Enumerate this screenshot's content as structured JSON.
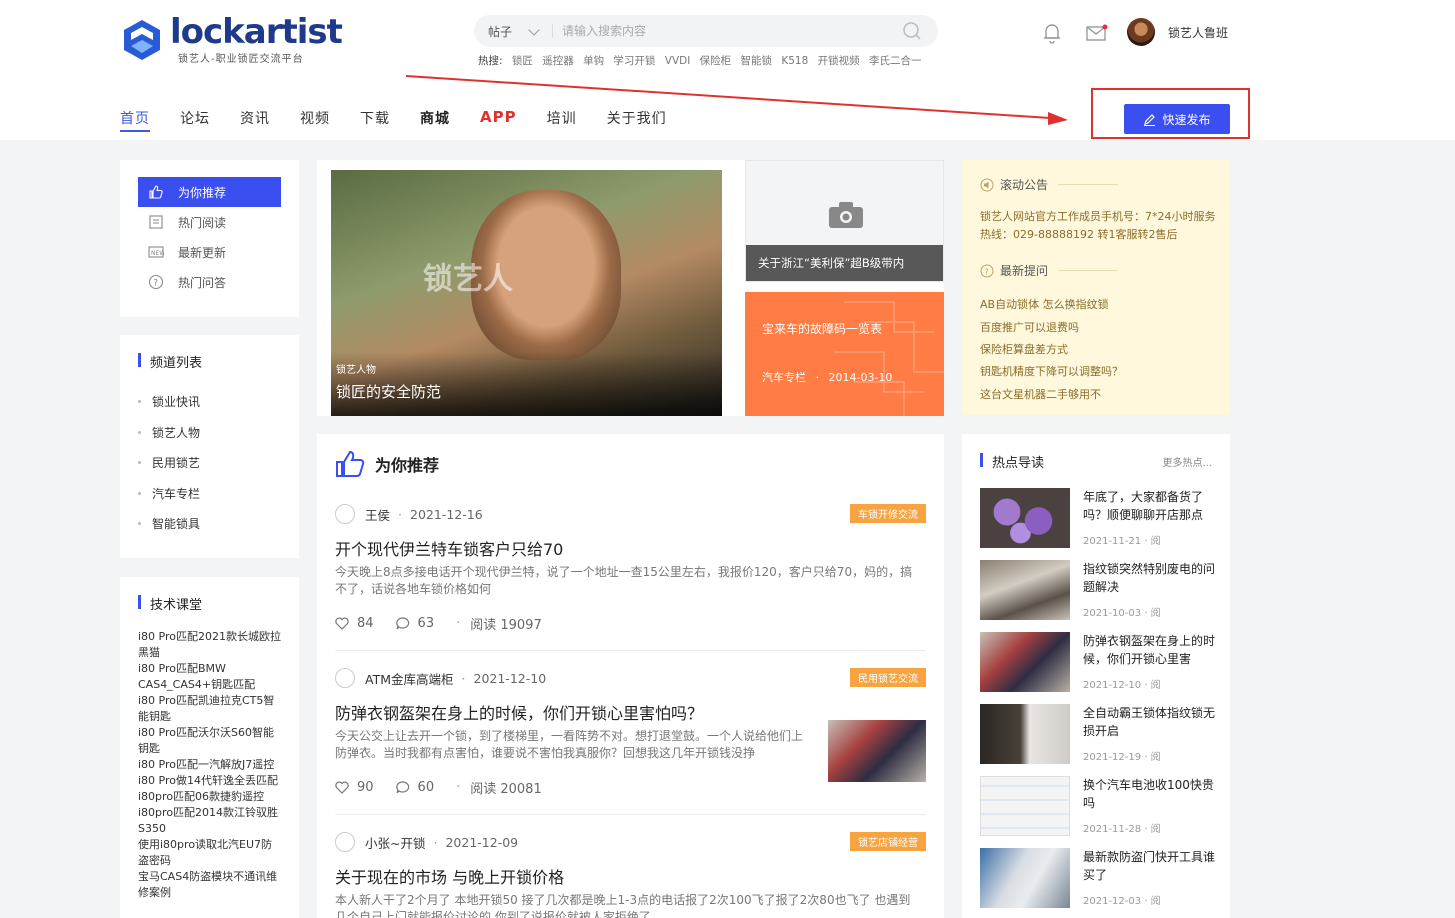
{
  "header": {
    "logo_text": "lockartist",
    "logo_tagline": "锁艺人-职业锁匠交流平台",
    "search": {
      "category": "帖子",
      "placeholder": "请输入搜索内容"
    },
    "hot_label": "热搜:",
    "hot_terms": [
      "锁匠",
      "遥控器",
      "单钩",
      "学习开锁",
      "VVDI",
      "保险柜",
      "智能锁",
      "K518",
      "开锁视频",
      "李氏二合一"
    ],
    "username": "锁艺人鲁班",
    "publish_label": "快速发布"
  },
  "nav": [
    {
      "label": "首页"
    },
    {
      "label": "论坛"
    },
    {
      "label": "资讯"
    },
    {
      "label": "视频"
    },
    {
      "label": "下载"
    },
    {
      "label": "商城"
    },
    {
      "label": "APP"
    },
    {
      "label": "培训"
    },
    {
      "label": "关于我们"
    }
  ],
  "side_menu": [
    {
      "label": "为你推荐",
      "icon": "thumbs-up-icon"
    },
    {
      "label": "热门阅读",
      "icon": "book-icon"
    },
    {
      "label": "最新更新",
      "icon": "new-icon"
    },
    {
      "label": "热门问答",
      "icon": "question-icon"
    }
  ],
  "channels": {
    "title": "频道列表",
    "items": [
      "锁业快讯",
      "锁艺人物",
      "民用锁艺",
      "汽车专栏",
      "智能锁具"
    ]
  },
  "course": {
    "title": "技术课堂",
    "items": [
      "i80 Pro匹配2021款长城欧拉黑猫",
      "i80 Pro匹配BMW CAS4_CAS4+钥匙匹配",
      "i80 Pro匹配凯迪拉克CT5智能钥匙",
      "i80 Pro匹配沃尔沃S60智能钥匙",
      "i80 Pro匹配一汽解放J7遥控",
      "i80 Pro做14代轩逸全丢匹配",
      "i80pro匹配06款捷豹遥控",
      "i80pro匹配2014款江铃驭胜S350",
      "使用i80pro读取北汽EU7防盗密码",
      "宝马CAS4防盗模块不通讯维修案例"
    ]
  },
  "banners": {
    "main": {
      "tag": "锁艺人物",
      "title": "锁匠的安全防范",
      "watermark": "锁艺人"
    },
    "r1": {
      "title": "关于浙江“美利保”超B级带内"
    },
    "r2": {
      "title": "宝来车的故障码一览表",
      "category": "汽车专栏",
      "date": "2014-03-10"
    }
  },
  "feed": {
    "title": "为你推荐",
    "posts": [
      {
        "author": "王侯",
        "date": "2021-12-16",
        "badge": "车锁开修交流",
        "title": "开个现代伊兰特车锁客户只给70",
        "excerpt": "今天晚上8点多接电话开个现代伊兰特，说了一个地址一查15公里左右，我报价120，客户只给70，妈的，搞不了，话说各地车锁价格如何",
        "likes": "84",
        "comments": "63",
        "reads": "阅读 19097"
      },
      {
        "author": "ATM金库高端柜",
        "date": "2021-12-10",
        "badge": "民用锁艺交流",
        "title": "防弹衣钢盔架在身上的时候，你们开锁心里害怕吗？",
        "excerpt": "今天公交上让去开一个锁，到了楼梯里，一看阵势不对。想打退堂鼓。一个人说给他们上防弹衣。当时我都有点害怕，谁要说不害怕我真服你？回想我这几年开锁钱没挣",
        "likes": "90",
        "comments": "60",
        "reads": "阅读 20081"
      },
      {
        "author": "小张~开锁",
        "date": "2021-12-09",
        "badge": "锁艺店铺经营",
        "title": "关于现在的市场 与晚上开锁价格",
        "excerpt": "本人新人干了2个月了 本地开锁50 接了几次都是晚上1-3点的电话报了2次100飞了报了2次80也飞了 也遇到几个自己上门就能报价讨论的 你到了说报价就被人家拒绝了"
      }
    ]
  },
  "notice": {
    "title": "滚动公告",
    "text": "锁艺人网站官方工作成员手机号：7*24小时服务热线：029-88888192 转1客服转2售后",
    "questions_title": "最新提问",
    "questions": [
      "AB自动锁体 怎么换指纹锁",
      "百度推广可以退费吗",
      "保险柜算盘差方式",
      "钥匙机精度下降可以调整吗？",
      "这台文星机器二手够用不"
    ]
  },
  "hotread": {
    "title": "热点导读",
    "more": "更多热点...",
    "items": [
      {
        "title": "年底了，大家都备货了吗？顺便聊聊开店那点",
        "date": "2021-11-21",
        "suffix": "阅"
      },
      {
        "title": "指纹锁突然特别废电的问题解决",
        "date": "2021-10-03",
        "suffix": "阅"
      },
      {
        "title": "防弹衣钢盔架在身上的时候，你们开锁心里害",
        "date": "2021-12-10",
        "suffix": "阅"
      },
      {
        "title": "全自动霸王锁体指纹锁无损开启",
        "date": "2021-12-19",
        "suffix": "阅"
      },
      {
        "title": "换个汽车电池收100快贵吗",
        "date": "2021-11-28",
        "suffix": "阅"
      },
      {
        "title": "最新款防盗门快开工具谁买了",
        "date": "2021-12-03",
        "suffix": "阅"
      }
    ]
  },
  "colors": {
    "accent": "#3b4ef0",
    "app_red": "#e03131",
    "badge": "#f7a440",
    "orange_banner": "#ff7d45",
    "notice_bg": "#fff8dc"
  }
}
